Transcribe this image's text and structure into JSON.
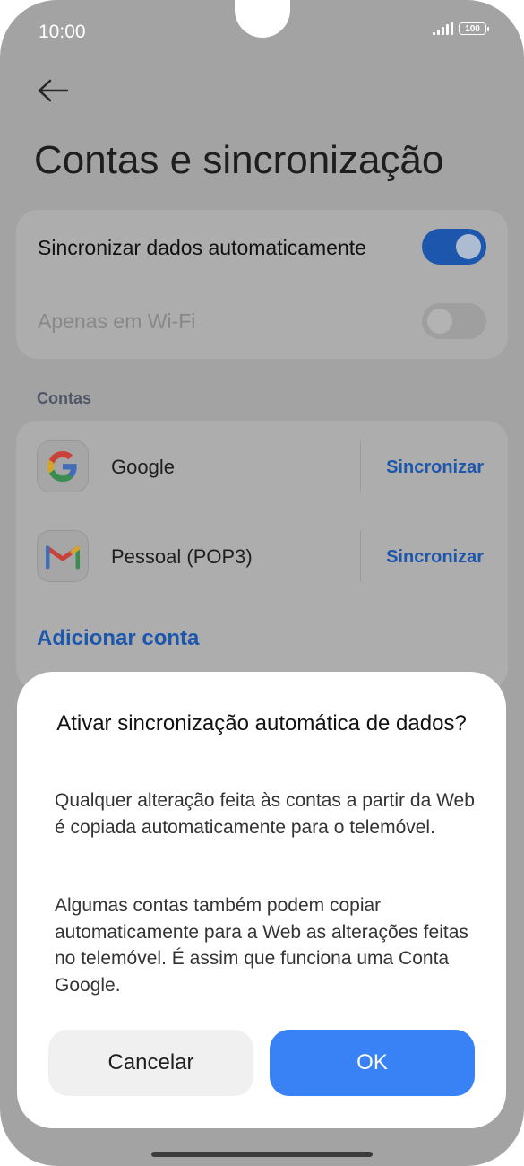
{
  "status_bar": {
    "time": "10:00",
    "battery": "100"
  },
  "page": {
    "title": "Contas e sincronização"
  },
  "sync_settings": {
    "auto_sync": {
      "label": "Sincronizar dados automaticamente",
      "enabled": true
    },
    "wifi_only": {
      "label": "Apenas em Wi-Fi",
      "enabled": false
    }
  },
  "accounts_section": {
    "label": "Contas",
    "items": [
      {
        "name": "Google",
        "icon": "google-icon",
        "action": "Sincronizar"
      },
      {
        "name": "Pessoal (POP3)",
        "icon": "gmail-icon",
        "action": "Sincronizar"
      }
    ],
    "add_label": "Adicionar conta"
  },
  "dialog": {
    "title": "Ativar sincronização automática de dados?",
    "paragraphs": [
      "Qualquer alteração feita às contas a partir da Web é copiada automaticamente para o telemóvel.",
      "Algumas contas também podem copiar automaticamente para a Web as alterações feitas no telemóvel. É assim que funciona uma Conta Google."
    ],
    "cancel_label": "Cancelar",
    "ok_label": "OK"
  },
  "colors": {
    "accent": "#3882F6",
    "link": "#1C57AD",
    "scrim_background": "#A3A3A3"
  }
}
